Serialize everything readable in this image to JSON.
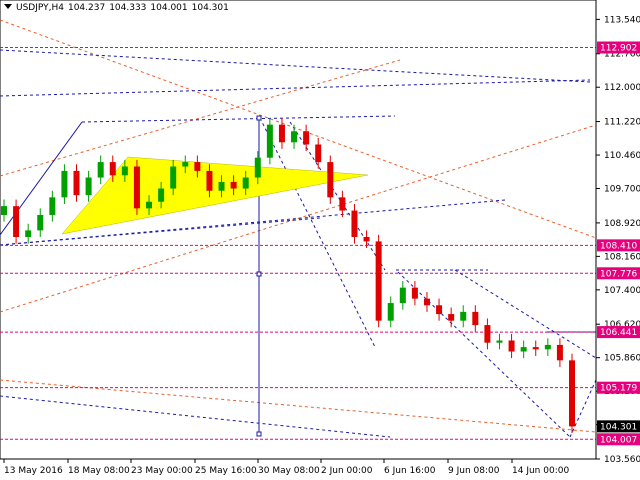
{
  "header": {
    "symbol": "USDJPY,H4",
    "open": "104.237",
    "high": "104.333",
    "low": "104.001",
    "close": "104.301"
  },
  "chart_data": {
    "type": "candlestick",
    "symbol": "USDJPY",
    "timeframe": "H4",
    "ylim": [
      103.56,
      113.98
    ],
    "y_ticks": [
      "113.540",
      "112.760",
      "112.000",
      "111.220",
      "110.460",
      "109.700",
      "108.920",
      "108.160",
      "107.400",
      "106.620",
      "105.860",
      "105.100",
      "104.340",
      "103.560"
    ],
    "x_ticks": [
      "13 May 2016",
      "18 May 08:00",
      "23 May 00:00",
      "25 May 16:00",
      "30 May 08:00",
      "2 Jun 00:00",
      "6 Jun 16:00",
      "9 Jun 08:00",
      "14 Jun 00:00"
    ],
    "level_lines": [
      {
        "value": "112.902",
        "color": "#e6007e"
      },
      {
        "value": "108.410",
        "color": "#e6007e"
      },
      {
        "value": "107.776",
        "color": "#e6007e"
      },
      {
        "value": "106.441",
        "color": "#e6007e"
      },
      {
        "value": "105.179",
        "color": "#e6007e"
      },
      {
        "value": "104.007",
        "color": "#e6007e"
      }
    ],
    "current_price": "104.301",
    "close_path": [
      [
        "13 May",
        109.3
      ],
      [
        "14 May",
        108.6
      ],
      [
        "16 May",
        108.75
      ],
      [
        "17 May",
        109.1
      ],
      [
        "17 May 12:00",
        109.5
      ],
      [
        "18 May",
        110.1
      ],
      [
        "18 May 08:00",
        109.55
      ],
      [
        "19 May",
        109.95
      ],
      [
        "19 May 12:00",
        110.3
      ],
      [
        "20 May",
        110.0
      ],
      [
        "20 May 12:00",
        110.2
      ],
      [
        "23 May",
        109.25
      ],
      [
        "23 May 12:00",
        109.4
      ],
      [
        "24 May",
        109.7
      ],
      [
        "24 May 12:00",
        110.2
      ],
      [
        "25 May",
        110.3
      ],
      [
        "25 May 12:00",
        110.1
      ],
      [
        "25 May 16:00",
        109.65
      ],
      [
        "26 May",
        109.85
      ],
      [
        "26 May 12:00",
        109.7
      ],
      [
        "27 May",
        109.95
      ],
      [
        "27 May 12:00",
        110.4
      ],
      [
        "29 May",
        111.15
      ],
      [
        "30 May",
        110.75
      ],
      [
        "30 May 08:00",
        111.0
      ],
      [
        "31 May",
        110.7
      ],
      [
        "31 May 12:00",
        110.3
      ],
      [
        "1 Jun",
        109.5
      ],
      [
        "1 Jun 12:00",
        109.2
      ],
      [
        "2 Jun",
        108.6
      ],
      [
        "2 Jun 12:00",
        108.5
      ],
      [
        "3 Jun",
        106.7
      ],
      [
        "3 Jun 12:00",
        107.1
      ],
      [
        "6 Jun",
        107.45
      ],
      [
        "6 Jun 16:00",
        107.2
      ],
      [
        "7 Jun",
        107.05
      ],
      [
        "8 Jun",
        106.85
      ],
      [
        "8 Jun 12:00",
        106.7
      ],
      [
        "9 Jun",
        106.9
      ],
      [
        "9 Jun 08:00",
        106.6
      ],
      [
        "10 Jun",
        106.2
      ],
      [
        "10 Jun 12:00",
        106.25
      ],
      [
        "13 Jun",
        106.0
      ],
      [
        "13 Jun 12:00",
        106.1
      ],
      [
        "14 Jun",
        106.05
      ],
      [
        "14 Jun 12:00",
        106.15
      ],
      [
        "15 Jun",
        105.8
      ],
      [
        "15 Jun 12:00",
        104.3
      ]
    ]
  }
}
